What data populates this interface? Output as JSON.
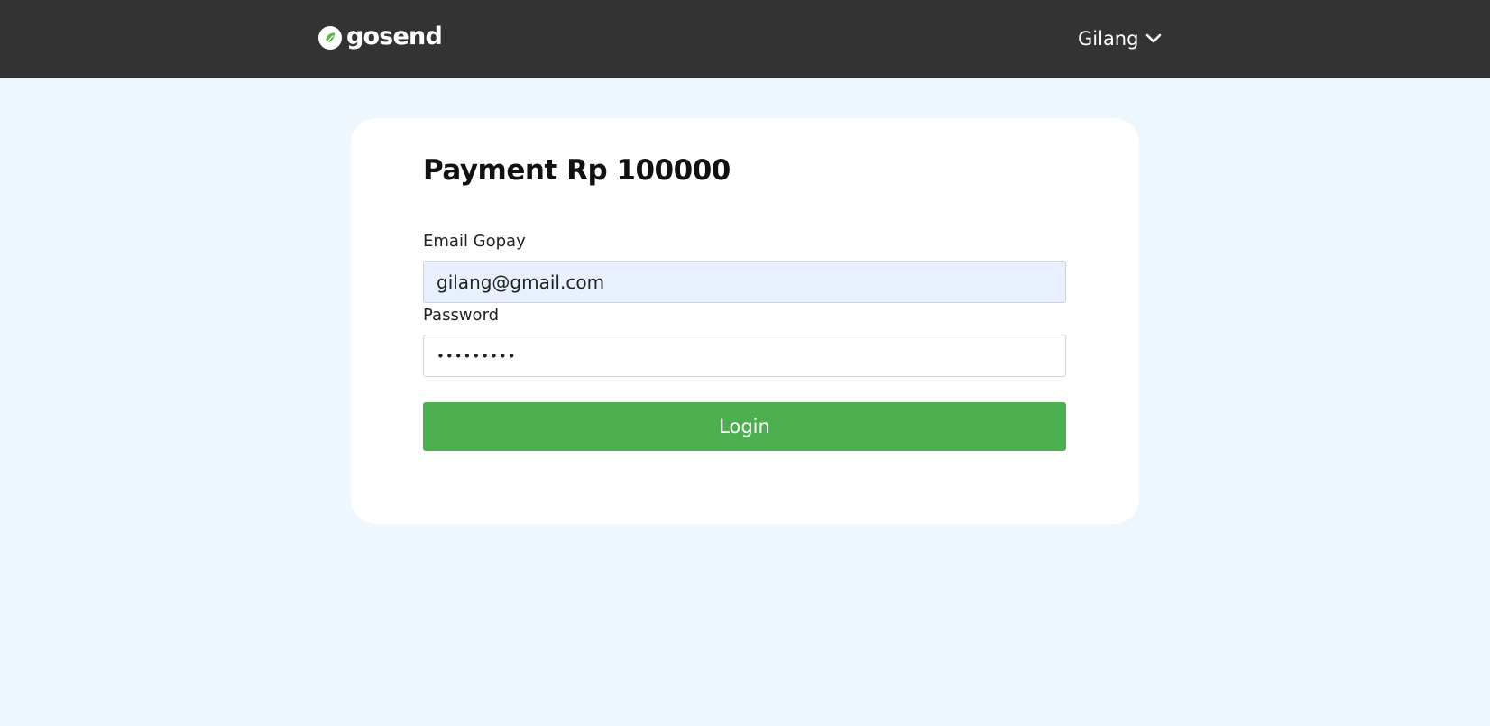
{
  "header": {
    "brand_name": "gosend",
    "brand_icon": "gosend-leaf-logo-icon",
    "user_name": "Gilang",
    "user_menu_icon": "chevron-down-icon"
  },
  "payment": {
    "title": "Payment Rp 100000",
    "email_label": "Email Gopay",
    "email_value": "gilang@gmail.com",
    "password_label": "Password",
    "password_value": "gilang123",
    "login_label": "Login"
  },
  "colors": {
    "header_bg": "#333333",
    "page_bg": "#eef6fe",
    "card_bg": "#ffffff",
    "button_green": "#4caf50",
    "autofill_bg": "#e8f0fe"
  }
}
